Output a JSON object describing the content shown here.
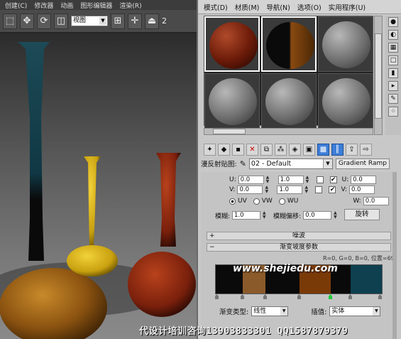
{
  "viewport": {
    "menu": [
      "创建(C)",
      "修改器",
      "动画",
      "图形编辑器",
      "渲染(R)"
    ],
    "view_dropdown": "视图",
    "snap_label": "2"
  },
  "material_editor": {
    "menu": [
      "模式(D)",
      "材质(M)",
      "导航(N)",
      "选项(O)",
      "实用程序(U)"
    ],
    "map_label": "漫反射贴图:",
    "map_name": "02 - Default",
    "map_type": "Gradient Ramp",
    "coords": {
      "u_label": "U:",
      "v_label": "V:",
      "w_label": "W:",
      "u_offset": "0.0",
      "v_offset": "0.0",
      "u_tiling": "1.0",
      "v_tiling": "1.0",
      "u_angle": "0.0",
      "v_angle": "0.0",
      "w_angle": "0.0",
      "uv": "UV",
      "vw": "VW",
      "wu": "WU",
      "blur_label": "模糊:",
      "blur": "1.0",
      "blur_offset_label": "模糊偏移:",
      "blur_offset": "0.0",
      "rotate": "旋转"
    },
    "rollouts": {
      "noise": "噪波",
      "gradient_params": "渐变坡度参数"
    },
    "gradient_info": "R=0, G=0, B=0,  位置=69",
    "gradient_colors": [
      "#0a0a0a",
      "#8b5a2b",
      "#0a0a0a",
      "#7a3a08",
      "#0a0a0a",
      "#0e4050"
    ],
    "gradient_type_label": "渐变类型:",
    "gradient_type": "线性",
    "interp_label": "插值:",
    "interp": "实体"
  },
  "overlay": {
    "site": "www.shejiedu.com",
    "footer": "代设计培训咨询13903833301  QQ1587879379"
  }
}
